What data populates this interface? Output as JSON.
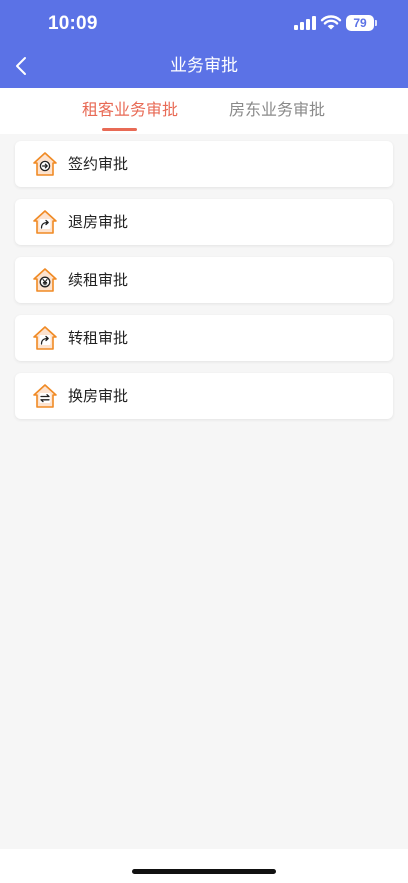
{
  "status_bar": {
    "time": "10:09",
    "battery_level": "79",
    "icons": [
      "signal-icon",
      "wifi-icon",
      "battery-icon"
    ]
  },
  "nav": {
    "title": "业务审批",
    "back_icon": "chevron-left-icon"
  },
  "tabs": [
    {
      "label": "租客业务审批",
      "active": true
    },
    {
      "label": "房东业务审批",
      "active": false
    }
  ],
  "items": [
    {
      "label": "签约审批",
      "icon": "house-arrow-right-icon"
    },
    {
      "label": "退房审批",
      "icon": "house-return-arrow-icon"
    },
    {
      "label": "续租审批",
      "icon": "house-yen-icon"
    },
    {
      "label": "转租审批",
      "icon": "house-forward-arrow-icon"
    },
    {
      "label": "换房审批",
      "icon": "house-swap-arrows-icon"
    }
  ],
  "colors": {
    "header": "#5b72e6",
    "accent": "#e86a55",
    "icon_orange": "#f08a24",
    "icon_fill": "#fde3cf",
    "background": "#f6f6f6"
  }
}
